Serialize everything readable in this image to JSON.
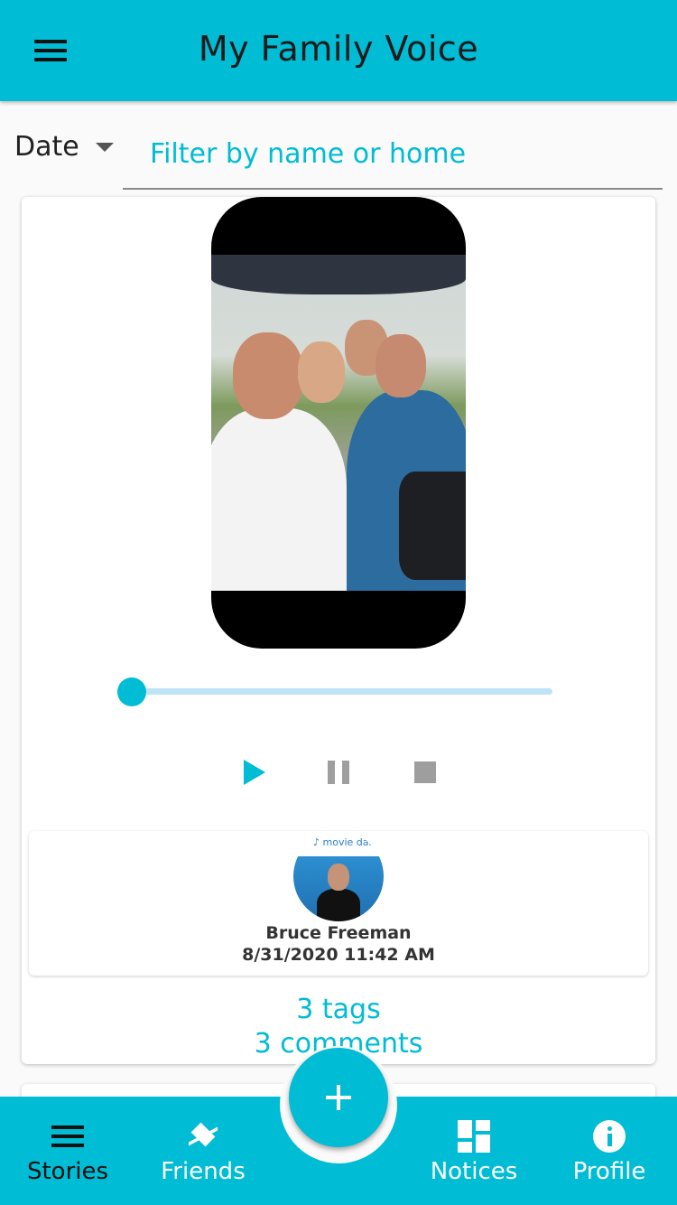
{
  "app": {
    "title": "My Family Voice",
    "accent_color": "#00bcd4"
  },
  "filter": {
    "sort_label": "Date",
    "placeholder": "Filter by name or home"
  },
  "story": {
    "playback_progress": 0,
    "author": {
      "name": "Bruce Freeman",
      "date": "8/31/2020 11:42 AM",
      "avatar_logo_text": "movie daily"
    },
    "tags_label": "3 tags",
    "comments_label": "3 comments"
  },
  "icons": {
    "menu": "menu-icon",
    "play": "play-icon",
    "pause": "pause-icon",
    "stop": "stop-icon",
    "add": "plus-icon"
  },
  "bottom_nav": {
    "stories": "Stories",
    "friends": "Friends",
    "notices": "Notices",
    "profile": "Profile",
    "active": "Stories"
  }
}
